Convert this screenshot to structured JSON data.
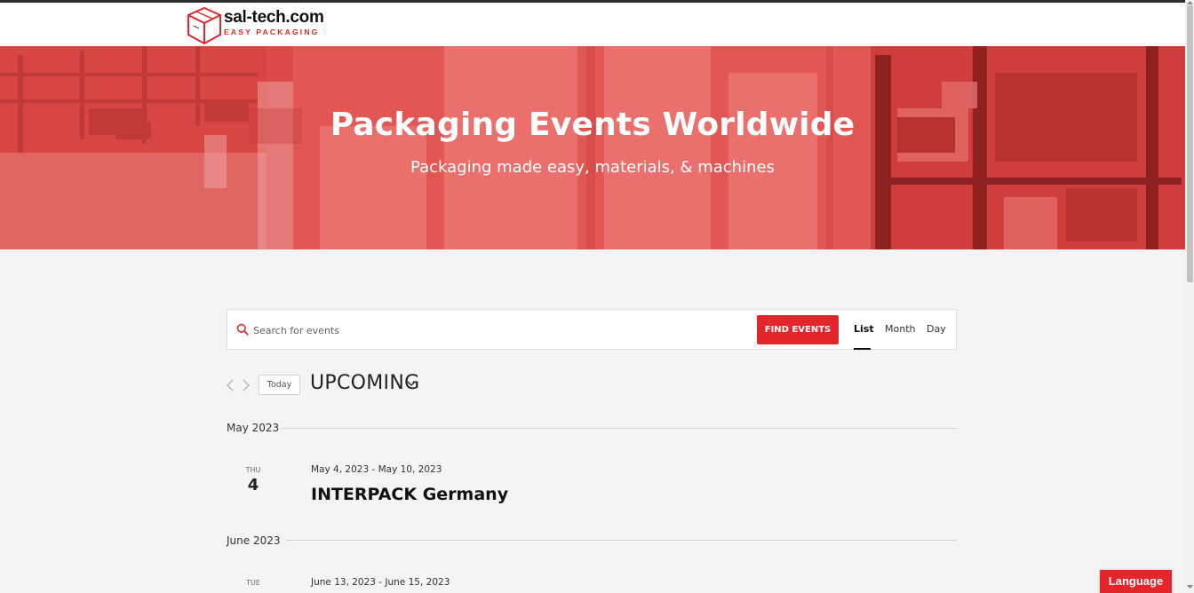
{
  "brand": {
    "name": "sal-tech.com",
    "tagline": "EASY PACKAGING",
    "accent": "#e3262b"
  },
  "hero": {
    "title": "Packaging Events Worldwide",
    "subtitle": "Packaging made easy, materials, & machines"
  },
  "search": {
    "placeholder": "Search for events",
    "value": "",
    "button_label": "FIND EVENTS",
    "icon": "search-icon"
  },
  "views": {
    "list": "List",
    "month": "Month",
    "day": "Day",
    "active": "List"
  },
  "nav": {
    "today_label": "Today",
    "range_label": "UPCOMING"
  },
  "months": [
    {
      "label": "May 2023",
      "events": [
        {
          "dow": "THU",
          "day": "4",
          "date_range": "May 4, 2023 - May 10, 2023",
          "title": "INTERPACK Germany"
        }
      ]
    },
    {
      "label": "June 2023",
      "events": [
        {
          "dow": "TUE",
          "day": "",
          "date_range": "June 13, 2023 - June 15, 2023",
          "title": ""
        }
      ]
    }
  ],
  "language_button": "Language"
}
